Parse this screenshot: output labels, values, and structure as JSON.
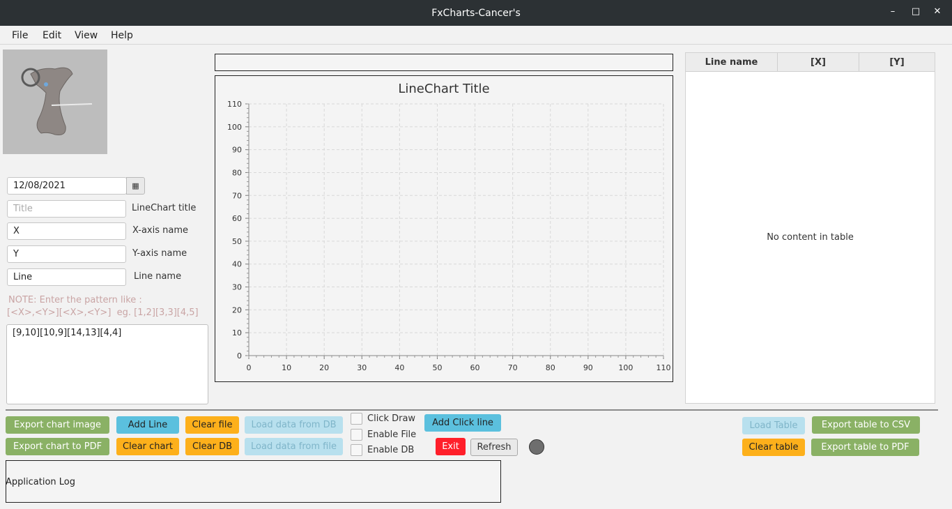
{
  "window": {
    "title": "FxCharts-Cancer's",
    "min_icon": "minimize-icon",
    "max_icon": "maximize-icon",
    "close_icon": "close-icon"
  },
  "menu": [
    "File",
    "Edit",
    "View",
    "Help"
  ],
  "form": {
    "date_value": "12/08/2021",
    "calendar_icon": "calendar-icon",
    "title_placeholder": "Title",
    "title_label": "LineChart title",
    "x_value": "X",
    "x_label": "X-axis name",
    "y_value": "Y",
    "y_label": "Y-axis name",
    "line_value": "Line",
    "line_label": "Line name",
    "note_line1": "NOTE: Enter the pattern like :",
    "note_line2": "[<X>,<Y>][<X>,<Y>]  eg. [1,2][3,3][4,5]",
    "pattern_value": "[9,10][10,9][14,13][4,4]"
  },
  "chart_data": {
    "type": "line",
    "title": "LineChart Title",
    "xlabel": "",
    "ylabel": "",
    "xlim": [
      0,
      110
    ],
    "ylim": [
      0,
      110
    ],
    "x_ticks": [
      0,
      10,
      20,
      30,
      40,
      50,
      60,
      70,
      80,
      90,
      100,
      110
    ],
    "y_ticks": [
      0,
      10,
      20,
      30,
      40,
      50,
      60,
      70,
      80,
      90,
      100,
      110
    ],
    "grid": true,
    "series": []
  },
  "table": {
    "columns": [
      "Line name",
      "[X]",
      "[Y]"
    ],
    "empty_text": "No content in table"
  },
  "buttons": {
    "export_chart_image": "Export chart image",
    "add_line": "Add Line",
    "clear_file": "Clear file",
    "load_db": "Load data from DB",
    "export_chart_pdf": "Export chart to PDF",
    "clear_chart": "Clear chart",
    "clear_db": "Clear DB",
    "load_file": "Load data from file",
    "add_click_line": "Add Click line",
    "exit": "Exit",
    "refresh": "Refresh",
    "load_table": "Load Table",
    "export_csv": "Export table to CSV",
    "clear_table": "Clear table",
    "export_table_pdf": "Export table to PDF"
  },
  "checks": {
    "click_draw": "Click Draw",
    "enable_file": "Enable File",
    "enable_db": "Enable DB"
  },
  "log": {
    "label": "Application Log"
  },
  "colors": {
    "green": "#8ab165",
    "blue": "#5bc0de",
    "orange": "#fdb01b",
    "red": "#ff1f2a",
    "titlebar": "#2c3134"
  }
}
